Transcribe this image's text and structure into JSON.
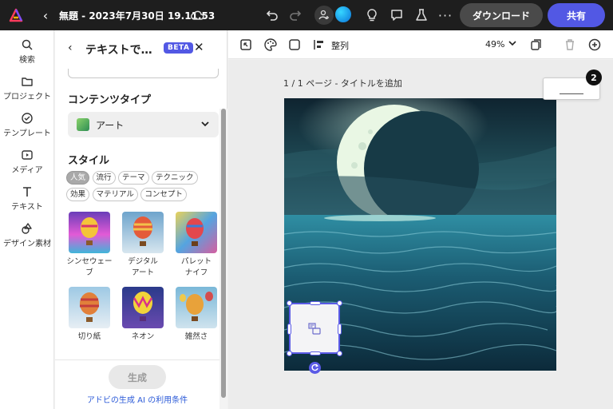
{
  "topbar": {
    "doc_title": "無題 - 2023年7月30日 19.11.53",
    "download_label": "ダウンロード",
    "share_label": "共有",
    "icons": [
      "adobe-express-logo",
      "chevron-left-icon",
      "cloud-icon",
      "undo-icon",
      "redo-icon",
      "invite-person-icon",
      "lightbulb-icon",
      "comment-icon",
      "flask-icon",
      "more-icon"
    ],
    "more_glyph": "···",
    "back_glyph": "‹",
    "share_color": "#5258e4"
  },
  "rail": {
    "items": [
      {
        "label": "検索",
        "icon": "search-icon"
      },
      {
        "label": "プロジェクト",
        "icon": "folder-icon"
      },
      {
        "label": "テンプレート",
        "icon": "template-icon"
      },
      {
        "label": "メディア",
        "icon": "media-icon"
      },
      {
        "label": "テキスト",
        "icon": "text-icon"
      },
      {
        "label": "デザイン素材",
        "icon": "shapes-icon"
      }
    ]
  },
  "panel": {
    "back_glyph": "‹",
    "title": "テキストで…",
    "beta_label": "BETA",
    "close_glyph": "✕",
    "content_type_heading": "コンテンツタイプ",
    "content_type_value": "アート",
    "style_heading": "スタイル",
    "tags": [
      {
        "label": "人気",
        "active": true
      },
      {
        "label": "流行",
        "active": false
      },
      {
        "label": "テーマ",
        "active": false
      },
      {
        "label": "テクニック",
        "active": false
      },
      {
        "label": "効果",
        "active": false
      },
      {
        "label": "マテリアル",
        "active": false
      },
      {
        "label": "コンセプト",
        "active": false
      }
    ],
    "styles": [
      {
        "name": "シンセウェーブ"
      },
      {
        "name": "デジタル\nアート"
      },
      {
        "name": "パレット\nナイフ"
      },
      {
        "name": "切り紙"
      },
      {
        "name": "ネオン"
      },
      {
        "name": "雑然さ"
      }
    ],
    "generate_label": "生成",
    "terms_link": "アドビの生成 AI の利用条件"
  },
  "canvas_toolbar": {
    "align_label": "整列",
    "zoom_label": "49%",
    "icons": [
      "resize-icon",
      "palette-icon",
      "square-icon",
      "align-icon",
      "duplicate-page-icon",
      "trash-icon",
      "add-page-icon"
    ]
  },
  "canvas": {
    "page_label": "1 / 1 ページ - タイトルを追加",
    "page_count": "2",
    "accent": "#5a5ae6"
  }
}
